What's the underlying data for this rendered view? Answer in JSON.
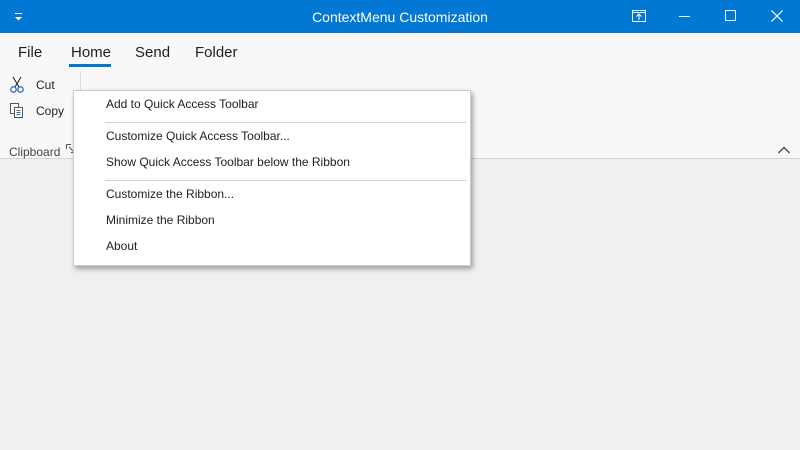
{
  "window": {
    "title": "ContextMenu Customization"
  },
  "ribbon": {
    "tabs": [
      {
        "label": "File"
      },
      {
        "label": "Home"
      },
      {
        "label": "Send"
      },
      {
        "label": "Folder"
      }
    ],
    "active_tab": "Home",
    "clipboard": {
      "cut_label": "Cut",
      "copy_label": "Copy",
      "group_label": "Clipboard"
    }
  },
  "context_menu": {
    "items": [
      {
        "label": "Add to Quick Access Toolbar"
      },
      {
        "label": "Customize Quick Access Toolbar..."
      },
      {
        "label": "Show Quick Access Toolbar below the Ribbon"
      },
      {
        "label": "Customize the Ribbon..."
      },
      {
        "label": "Minimize the Ribbon"
      },
      {
        "label": "About"
      }
    ]
  },
  "colors": {
    "accent": "#0078d4",
    "background": "#f0f0f0",
    "ribbon_background": "#f8f8f8"
  },
  "icons": [
    "quick-access-customize-icon",
    "restore-ribbon-icon",
    "minimize-icon",
    "maximize-icon",
    "close-icon",
    "cut-icon",
    "copy-icon",
    "dialog-launcher-icon",
    "chevron-up-icon"
  ]
}
